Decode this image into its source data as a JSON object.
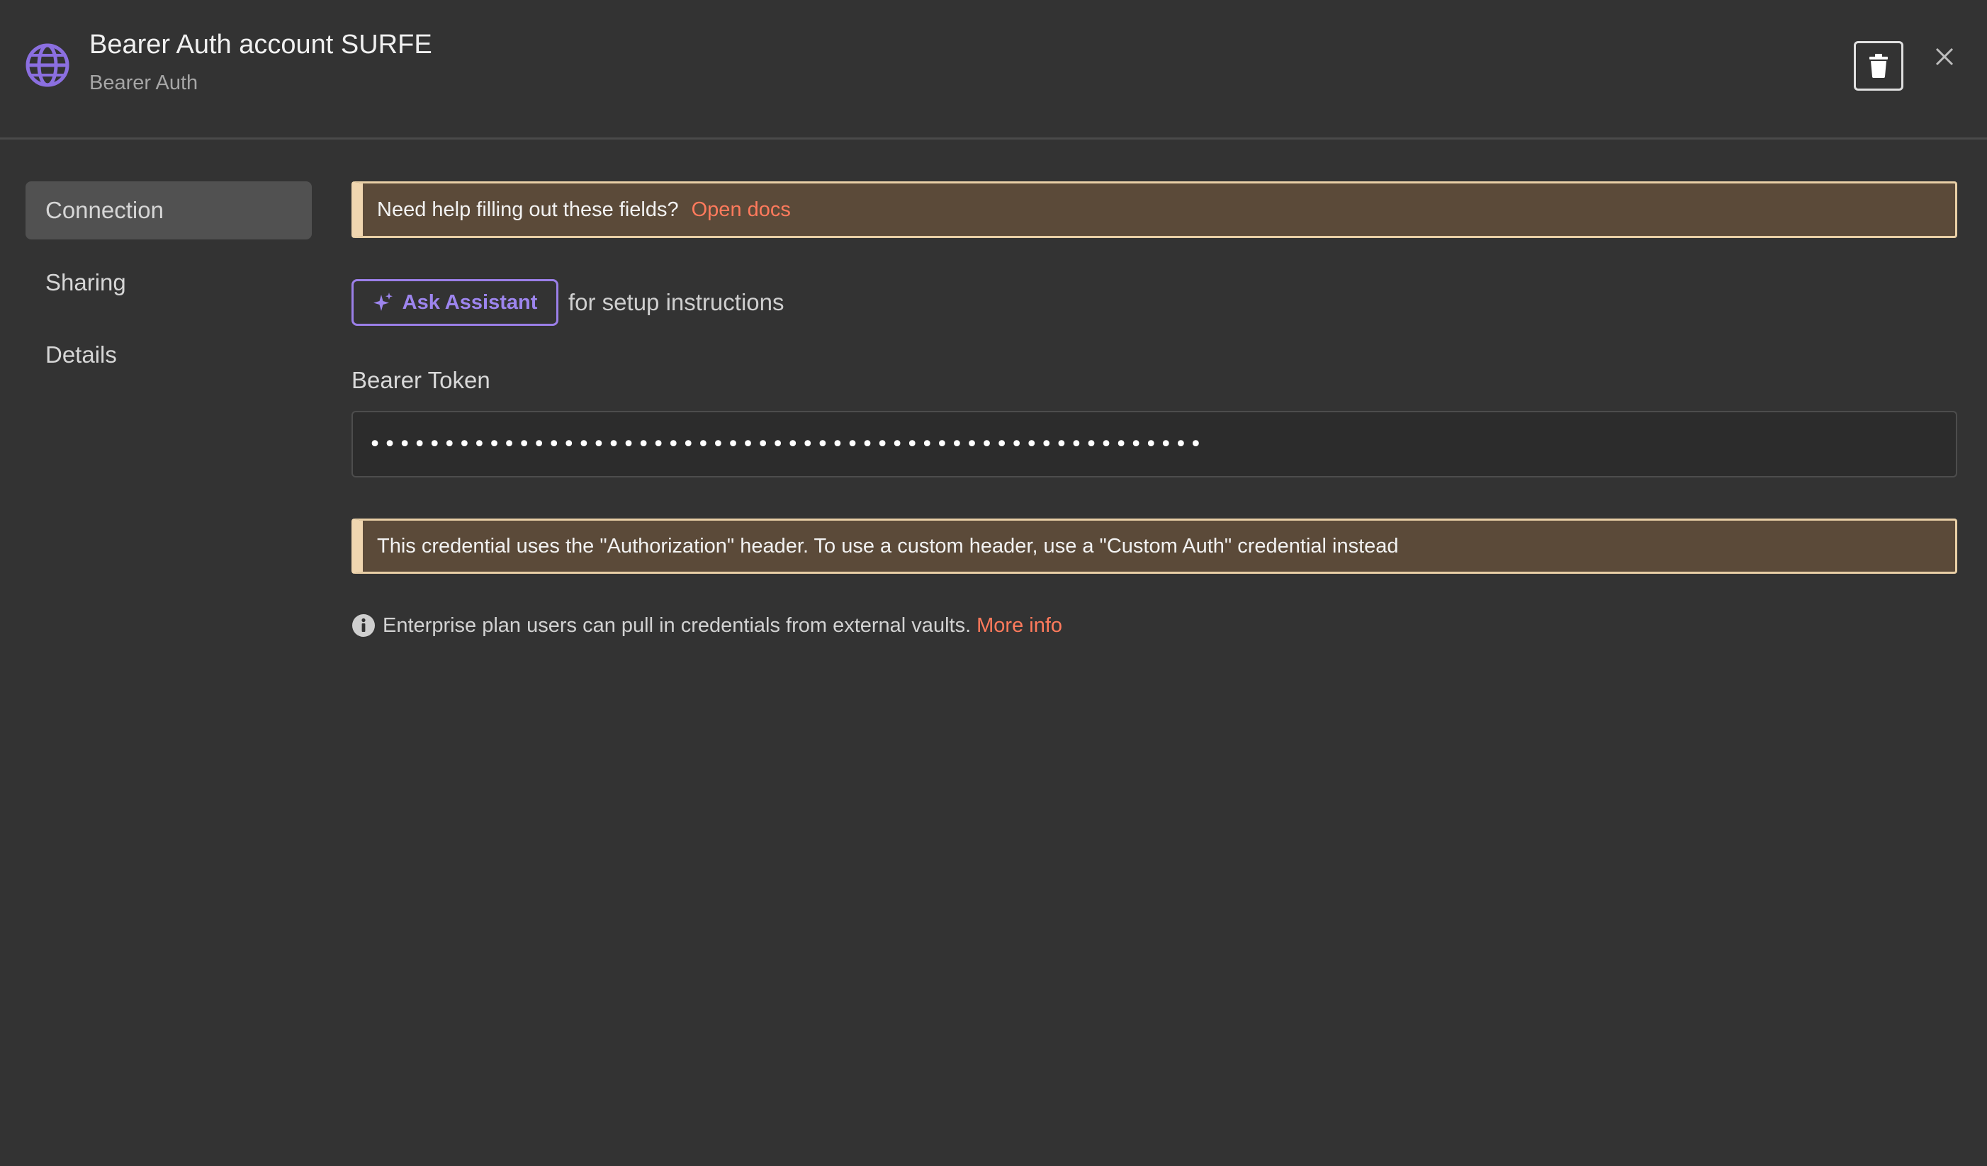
{
  "header": {
    "title": "Bearer Auth account SURFE",
    "subtitle": "Bearer Auth",
    "icon": "globe-icon",
    "delete_icon": "trash-icon",
    "close_icon": "close-icon",
    "accent_color": "#8b6fe0"
  },
  "sidebar": {
    "items": [
      {
        "label": "Connection",
        "active": true
      },
      {
        "label": "Sharing",
        "active": false
      },
      {
        "label": "Details",
        "active": false
      }
    ]
  },
  "main": {
    "help_callout": {
      "text": "Need help filling out these fields?",
      "link": "Open docs"
    },
    "assistant": {
      "button_label": "Ask Assistant",
      "suffix": "for setup instructions",
      "icon": "sparkle-icon"
    },
    "bearer_token": {
      "label": "Bearer Token",
      "value": "••••••••••••••••••••••••••••••••••••••••••••••••••••••••"
    },
    "header_callout": {
      "text": "This credential uses the \"Authorization\" header. To use a custom header, use a \"Custom Auth\" credential instead"
    },
    "enterprise_note": {
      "text": "Enterprise plan users can pull in credentials from external vaults.",
      "link": "More info",
      "icon": "info-icon"
    }
  },
  "colors": {
    "background": "#333333",
    "callout_bg": "#5b4a39",
    "callout_border": "#f0d6b0",
    "link": "#ff7a5c",
    "assistant": "#9d85ee"
  }
}
